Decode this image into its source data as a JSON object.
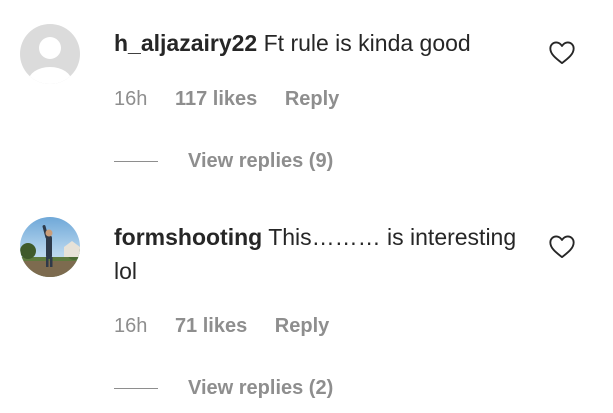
{
  "comments": [
    {
      "username": "h_aljazairy22",
      "text": "Ft rule is kinda good",
      "time": "16h",
      "likes": "117 likes",
      "reply_label": "Reply",
      "view_replies": "View replies (9)",
      "avatar": "default-avatar",
      "like_icon": "heart-outline-icon"
    },
    {
      "username": "formshooting",
      "text": "This……… is interesting lol",
      "time": "16h",
      "likes": "71 likes",
      "reply_label": "Reply",
      "view_replies": "View replies (2)",
      "avatar": "photo-avatar",
      "like_icon": "heart-outline-icon"
    }
  ],
  "colors": {
    "text_primary": "#262626",
    "text_secondary": "#8e8e8e",
    "background": "#ffffff"
  }
}
